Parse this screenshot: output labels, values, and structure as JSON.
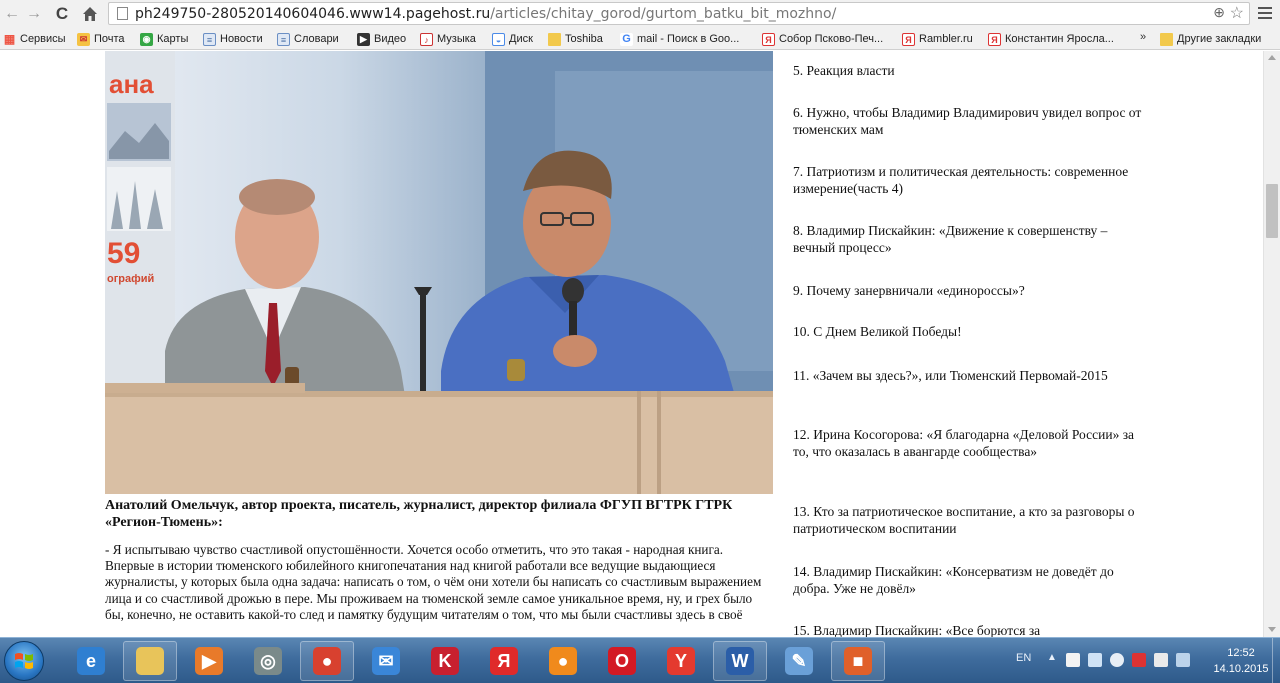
{
  "browser": {
    "url_host": "ph249750-280520140604046.www14.pagehost.ru",
    "url_path": "/articles/chitay_gorod/gurtom_batku_bit_mozhno/",
    "bookmarks": [
      {
        "label": "Сервисы",
        "icon": "apps-icon"
      },
      {
        "label": "Почта",
        "icon": "mail-icon"
      },
      {
        "label": "Карты",
        "icon": "maps-icon"
      },
      {
        "label": "Новости",
        "icon": "news-icon"
      },
      {
        "label": "Словари",
        "icon": "dictionary-icon"
      },
      {
        "label": "Видео",
        "icon": "video-icon"
      },
      {
        "label": "Музыка",
        "icon": "music-icon"
      },
      {
        "label": "Диск",
        "icon": "disk-icon"
      },
      {
        "label": "Toshiba",
        "icon": "folder-icon"
      },
      {
        "label": "mail - Поиск в Goo...",
        "icon": "google-icon"
      },
      {
        "label": "Собор Псково-Печ...",
        "icon": "yandex-icon"
      },
      {
        "label": "Rambler.ru",
        "icon": "yandex-icon"
      },
      {
        "label": "Константин Яросла...",
        "icon": "yandex-icon"
      }
    ],
    "bookmarks_more": "»",
    "other_bookmarks": "Другие закладки"
  },
  "article": {
    "photo_poster_word": "ана",
    "photo_poster_number": "59",
    "photo_poster_sub": "ографий",
    "speaker_caption": "Анатолий Омельчук, автор проекта, писатель, журналист, директор филиала ФГУП ВГТРК ГТРК «Регион-Тюмень»:",
    "speech_text": "- Я испытываю чувство счастливой опустошённости. Хочется особо отметить, что это такая - народная книга. Впервые в истории тюменского юбилейного книгопечатания над книгой работали все ведущие выдающиеся журналисты, у которых была одна задача: написать о том, о чём они хотели бы написать со счастливым выражением лица и со счастливой дрожью в пере. Мы проживаем на тюменской земле самое уникальное время, ну, и грех было бы, конечно, не оставить какой-то след и памятку будущим читателям о том, что мы были счастливы здесь в своё"
  },
  "sidebar": {
    "articles": [
      "5. Реакция власти",
      "6. Нужно, чтобы Владимир Владимирович увидел вопрос от тюменских мам",
      "7. Патриотизм и политическая деятельность: современное измерение(часть 4)",
      "8. Владимир Пискайкин: «Движение к совершенству – вечный процесс»",
      "9. Почему занервничали «единороссы»?",
      "10. С Днем Великой Победы!",
      "11. «Зачем вы здесь?», или Тюменский Первомай-2015",
      "12. Ирина Косогорова: «Я благодарна «Деловой России» за то, что оказалась в авангарде сообщества»",
      "13. Кто за патриотическое воспитание, а кто за разговоры о патриотическом воспитании",
      "14. Владимир Пискайкин: «Консерватизм не доведёт до добра. Уже не довёл»",
      "15. Владимир Пискайкин: «Все борются за"
    ]
  },
  "taskbar": {
    "apps": [
      {
        "name": "internet-explorer-icon",
        "glyph": "e",
        "color": "#2f7fd1",
        "pinned": false
      },
      {
        "name": "explorer-folder-icon",
        "glyph": "",
        "color": "#e8c45a",
        "pinned": true
      },
      {
        "name": "media-player-icon",
        "glyph": "▶",
        "color": "#e87a2a",
        "pinned": false
      },
      {
        "name": "ring-app-icon",
        "glyph": "◎",
        "color": "#7a8a8a",
        "pinned": false
      },
      {
        "name": "chrome-icon",
        "glyph": "●",
        "color": "#d8412f",
        "pinned": true
      },
      {
        "name": "mail-agent-icon",
        "glyph": "✉",
        "color": "#3a86d8",
        "pinned": false
      },
      {
        "name": "kaspersky-icon",
        "glyph": "K",
        "color": "#c8202f",
        "pinned": false
      },
      {
        "name": "yandex-icon",
        "glyph": "Я",
        "color": "#e02a2a",
        "pinned": false
      },
      {
        "name": "odnoklassniki-icon",
        "glyph": "●",
        "color": "#f08a1c",
        "pinned": false
      },
      {
        "name": "opera-icon",
        "glyph": "O",
        "color": "#d31a24",
        "pinned": false
      },
      {
        "name": "yandex-browser-icon",
        "glyph": "Y",
        "color": "#e43a2f",
        "pinned": false
      },
      {
        "name": "word-icon",
        "glyph": "W",
        "color": "#2b5ea8",
        "pinned": true
      },
      {
        "name": "paint-icon",
        "glyph": "✎",
        "color": "#6aa0d8",
        "pinned": false
      },
      {
        "name": "photo-viewer-icon",
        "glyph": "■",
        "color": "#e0602a",
        "pinned": true
      }
    ],
    "language": "EN",
    "time": "12:52",
    "date": "14.10.2015"
  }
}
